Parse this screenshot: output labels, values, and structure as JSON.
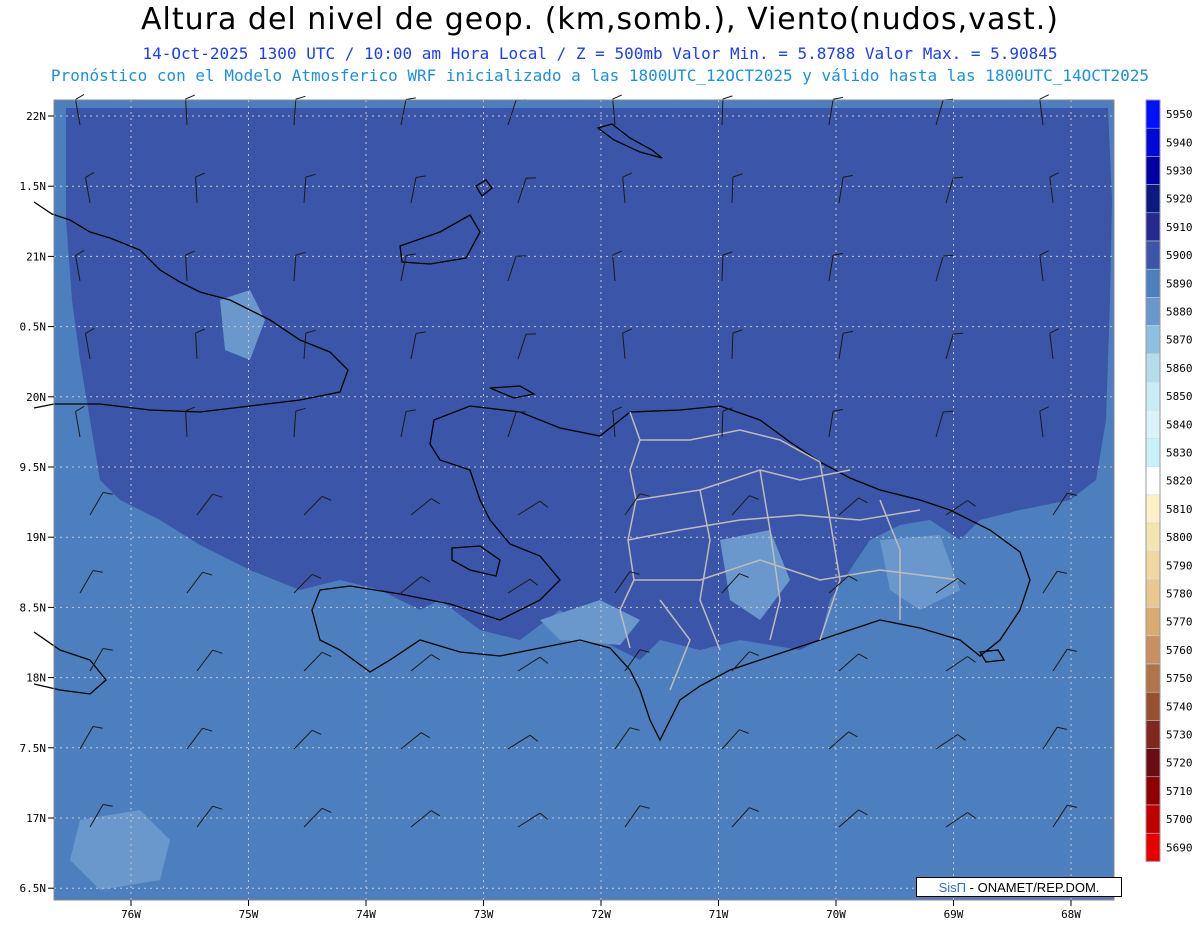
{
  "header": {
    "title": "Altura del nivel de geop. (km,somb.), Viento(nudos,vast.)",
    "line1": "14-Oct-2025  1300 UTC / 10:00 am Hora Local / Z = 500mb     Valor Min. = 5.8788  Valor Max. = 5.90845",
    "line2": "Pronóstico con el Modelo Atmosferico WRF inicializado a las 1800UTC_12OCT2025 y válido hasta las  1800UTC_14OCT2025"
  },
  "axes": {
    "lat_labels": [
      "22N",
      "1.5N",
      "21N",
      "0.5N",
      "20N",
      "9.5N",
      "19N",
      "8.5N",
      "18N",
      "7.5N",
      "17N",
      "6.5N"
    ],
    "lon_labels": [
      "76W",
      "75W",
      "74W",
      "73W",
      "72W",
      "71W",
      "70W",
      "69W",
      "68W"
    ]
  },
  "colorbar": {
    "levels": [
      "5950",
      "5940",
      "5930",
      "5920",
      "5910",
      "5900",
      "5890",
      "5880",
      "5870",
      "5860",
      "5850",
      "5840",
      "5830",
      "5820",
      "5810",
      "5800",
      "5790",
      "5780",
      "5770",
      "5760",
      "5750",
      "5740",
      "5730",
      "5720",
      "5710",
      "5700",
      "5690"
    ],
    "colors": [
      "#0010ff",
      "#0008d8",
      "#0000a8",
      "#0a1a80",
      "#252a90",
      "#3b56a8",
      "#4d7fbe",
      "#6a98cc",
      "#8dbfe0",
      "#b4dcec",
      "#c8ecf4",
      "#d8f4f8",
      "#c8f2f8",
      "#ffffff",
      "#fbf0c8",
      "#f6e4b0",
      "#f0d8a0",
      "#e8c890",
      "#d8ac70",
      "#c89060",
      "#b07448",
      "#985030",
      "#802820",
      "#6a0c10",
      "#900000",
      "#c00000",
      "#e80000"
    ],
    "base_color": "#4d7fbe",
    "high_color": "#3b56a8",
    "mid_color": "#6a98cc"
  },
  "credit": {
    "logo": "SisΠ",
    "text": "- ONAMET/REP.DOM."
  }
}
